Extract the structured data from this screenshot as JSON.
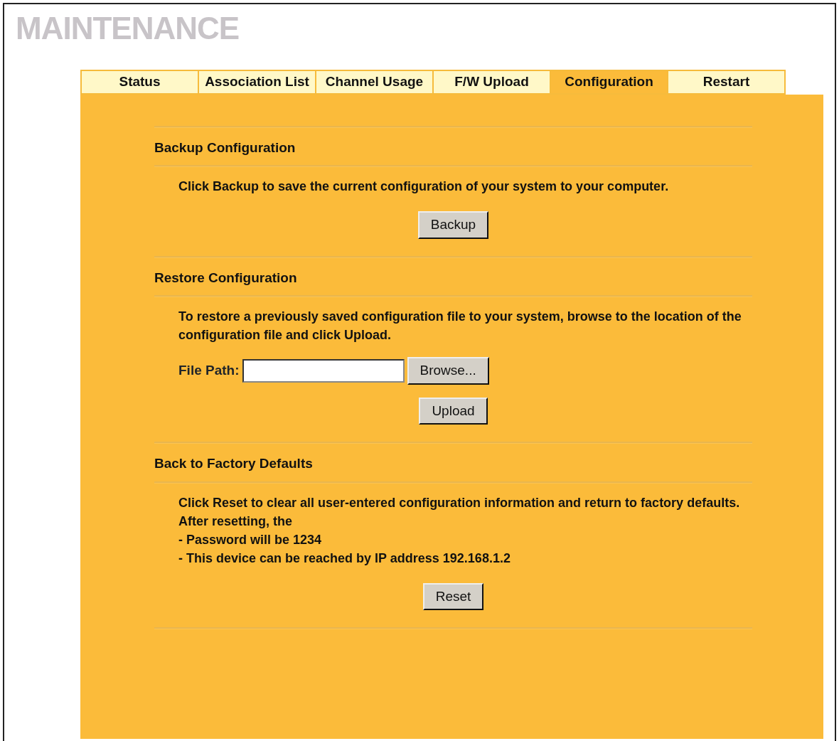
{
  "page_title": "MAINTENANCE",
  "tabs": [
    {
      "label": "Status",
      "selected": false
    },
    {
      "label": "Association List",
      "selected": false
    },
    {
      "label": "Channel Usage",
      "selected": false
    },
    {
      "label": "F/W Upload",
      "selected": false
    },
    {
      "label": "Configuration",
      "selected": true
    },
    {
      "label": "Restart",
      "selected": false
    }
  ],
  "sections": [
    {
      "title": "Backup Configuration",
      "paragraphs": [
        "Click Backup to save the current configuration of your system to your computer."
      ],
      "button": "Backup"
    },
    {
      "title": "Restore Configuration",
      "paragraphs": [
        "To restore a previously saved configuration file to your system, browse to the location of the configuration file and click Upload."
      ],
      "file_field": {
        "label": "File Path:",
        "browse_button": "Browse..."
      },
      "button": "Upload"
    },
    {
      "title": "Back to Factory Defaults",
      "paragraphs": [
        "Click Reset to clear all user-entered configuration information and return to factory defaults. After resetting, the",
        "- Password will be 1234",
        "- This device can be reached by IP address 192.168.1.2"
      ],
      "button": "Reset"
    }
  ]
}
